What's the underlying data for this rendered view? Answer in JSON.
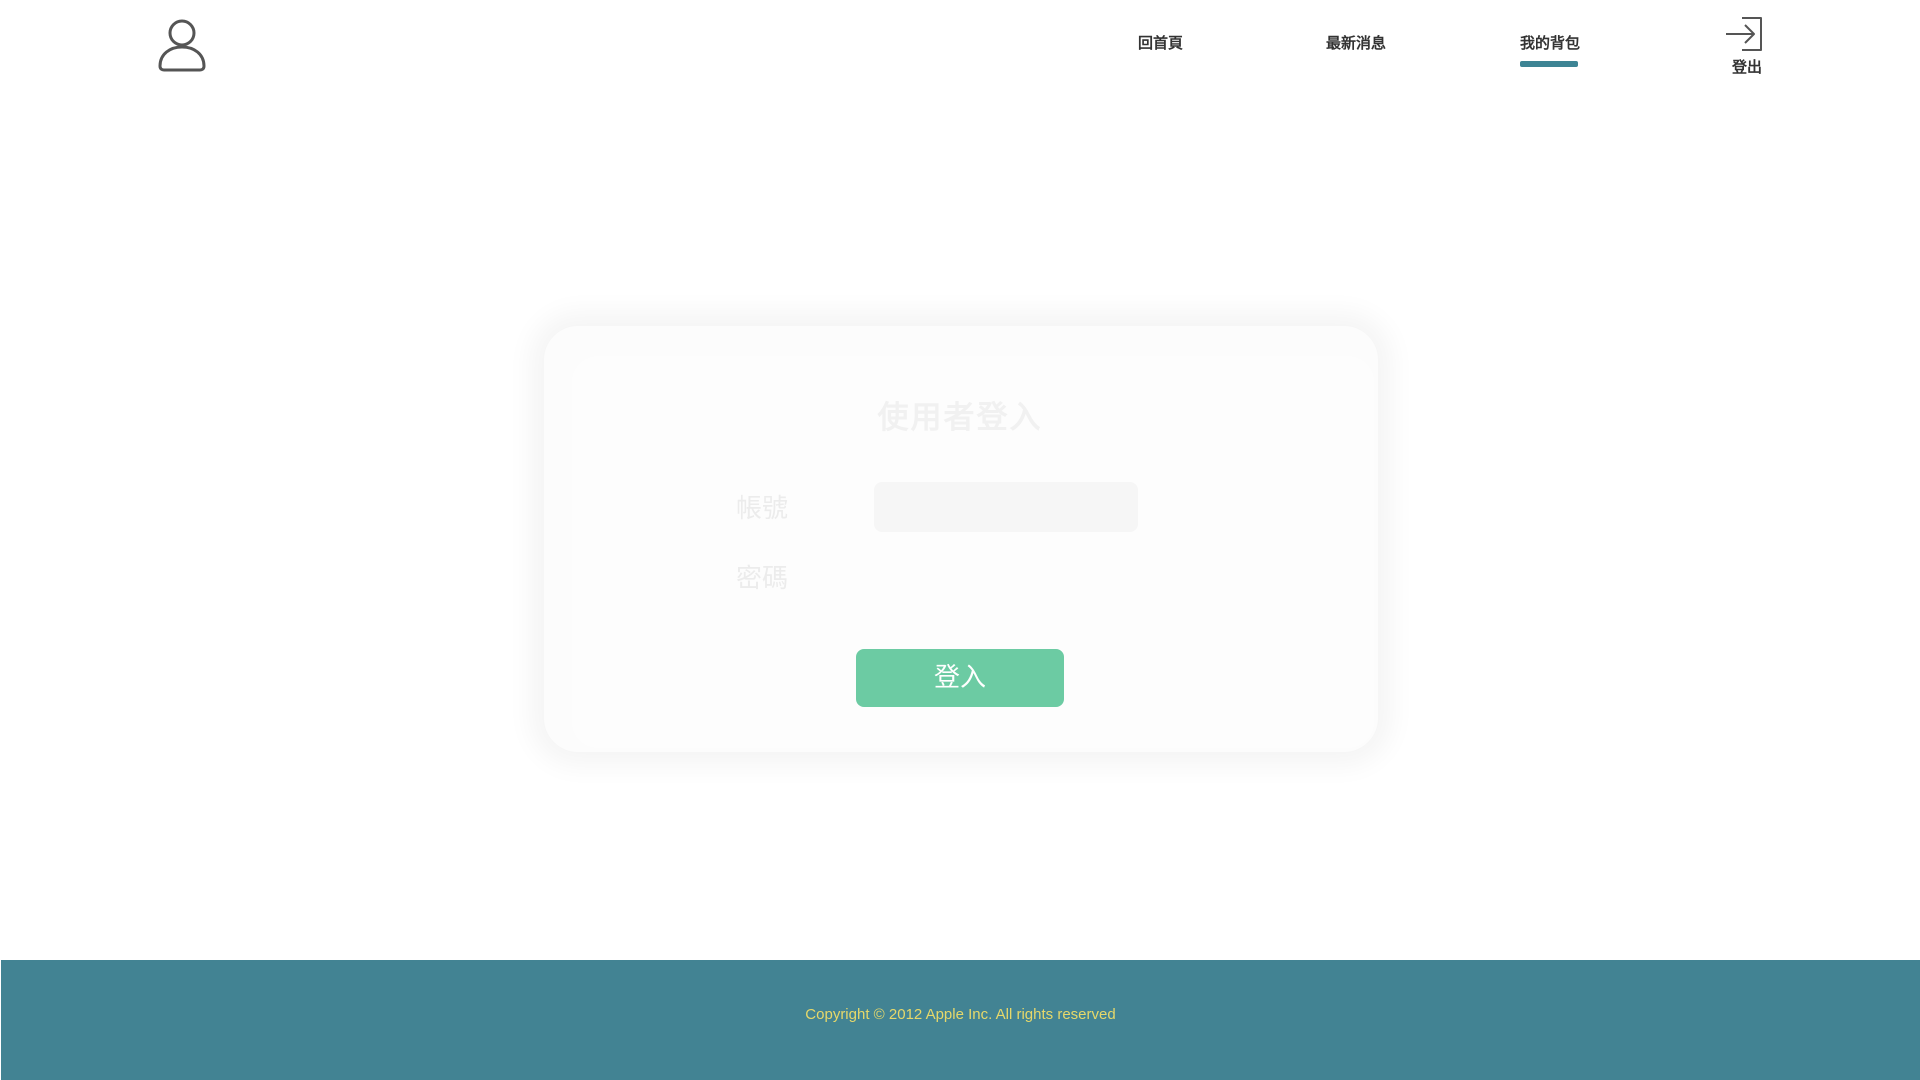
{
  "header": {
    "user_icon": "user-icon",
    "nav": {
      "home": "回首頁",
      "news": "最新消息",
      "bag": "我的背包"
    },
    "active_nav": "bag",
    "logout_icon": "sign-in-arrow-icon",
    "logout_label": "登出"
  },
  "login_card": {
    "title": "使用者登入",
    "account_label": "帳號",
    "password_label": "密碼",
    "account_value": "",
    "password_value": "",
    "submit_label": "登入"
  },
  "footer": {
    "copyright": "Copyright © 2012 Apple Inc. All rights reserved"
  },
  "colors": {
    "accent": "#428393",
    "active_underline": "#3d8494",
    "button": "#6ccba3",
    "copyright_text": "#e6d86a"
  }
}
